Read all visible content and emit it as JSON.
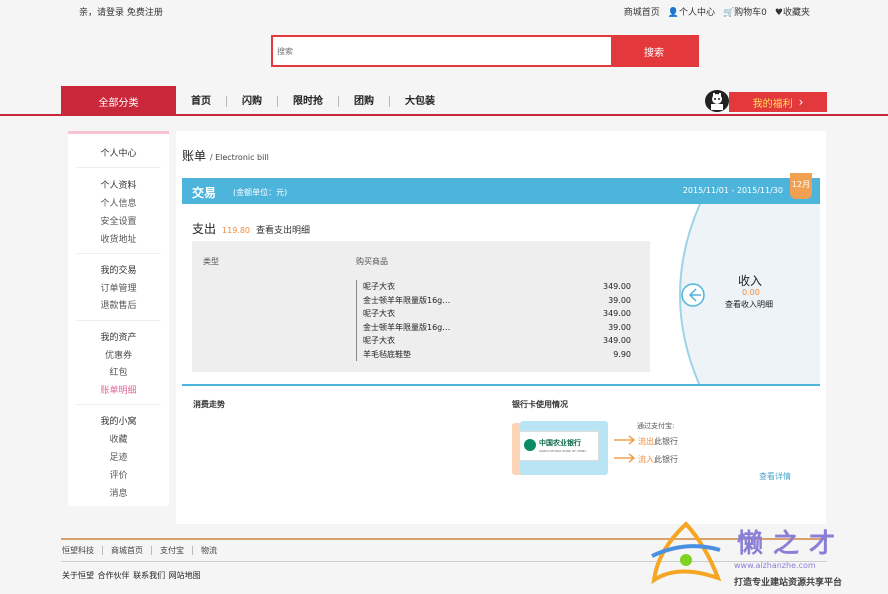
{
  "topbar": {
    "greeting": "亲，请登录 免费注册",
    "links": [
      "商城首页",
      "个人中心",
      "购物车0",
      "收藏夹"
    ]
  },
  "search": {
    "placeholder": "搜索",
    "button": "搜索"
  },
  "nav": {
    "all_categories": "全部分类",
    "links": [
      "首页",
      "闪购",
      "限时抢",
      "团购",
      "大包装"
    ],
    "welfare": "我的福利",
    "welfare_arrow": "›"
  },
  "sidebar": {
    "title": "个人中心",
    "sections": [
      {
        "title": "个人资料",
        "items": [
          "个人信息",
          "安全设置",
          "收货地址"
        ]
      },
      {
        "title": "我的交易",
        "items": [
          "订单管理",
          "退款售后"
        ]
      },
      {
        "title": "我的资产",
        "items": [
          "优惠券",
          "红包",
          "账单明细"
        ]
      },
      {
        "title": "我的小窝",
        "items": [
          "收藏",
          "足迹",
          "评价",
          "消息"
        ]
      }
    ],
    "active_item": "账单明细",
    "active_color": "#e4679b"
  },
  "main": {
    "title": "账单",
    "subtitle": "/ Electronic bill",
    "bar": {
      "label": "交易",
      "unit": "(金额单位：元)",
      "range": "2015/11/01 - 2015/11/30",
      "month": "12月"
    },
    "expense": {
      "label": "支出",
      "amount": "119.80",
      "link": "查看支出明细"
    },
    "detail": {
      "col_type": "类型",
      "col_goods": "购买商品",
      "rows": [
        {
          "name": "呢子大衣",
          "price": "349.00"
        },
        {
          "name": "金士顿羊年限量版16g…",
          "price": "39.00"
        },
        {
          "name": "呢子大衣",
          "price": "349.00"
        },
        {
          "name": "金士顿羊年限量版16g…",
          "price": "39.00"
        },
        {
          "name": "呢子大衣",
          "price": "349.00"
        },
        {
          "name": "羊毛毡底鞋垫",
          "price": "9.90"
        }
      ]
    },
    "income": {
      "label": "收入",
      "amount": "0.00",
      "link": "查看收入明细"
    },
    "trend": "消费走势",
    "bank_title": "银行卡使用情况",
    "bank_name": "中国农业银行",
    "bank_en": "AGRICULTURAL BANK OF CHINA",
    "via": "通过支付宝:",
    "out_word": "流出",
    "out_rest": "此银行",
    "in_word": "流入",
    "in_rest": "此银行",
    "more": "查看详情"
  },
  "footer": {
    "links": [
      "恒望科技",
      "商城首页",
      "支付宝",
      "物流"
    ],
    "about": "关于恒望 合作伙伴 联系我们 网站地图"
  },
  "watermark": {
    "title": "懒之才",
    "url": "www.aizhanzhe.com",
    "tagline": "打造专业建站资源共享平台"
  },
  "colors": {
    "brand_red": "#e4393c",
    "nav_red": "#c9283b",
    "blue": "#4db5dc",
    "orange": "#f08c3c"
  }
}
